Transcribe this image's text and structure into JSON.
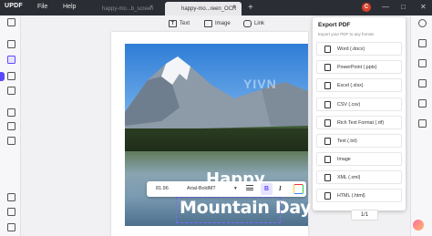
{
  "app": {
    "logo": "UPDF",
    "menu": {
      "file": "File",
      "help": "Help"
    },
    "tabs": [
      {
        "label": "happy-mo...b_screen",
        "close": "×"
      },
      {
        "label": "happy-mo...reen_OCR",
        "close": "×"
      }
    ],
    "new_tab": "+",
    "avatar_initial": "C",
    "window_controls": {
      "minimize": "—",
      "maximize": "□",
      "close": "✕"
    }
  },
  "toolbar": {
    "text_label": "Text",
    "image_label": "Image",
    "link_label": "Link"
  },
  "canvas": {
    "watermark": "YIVN",
    "overlay_line1": "Happy",
    "overlay_line2": "Mountain Day"
  },
  "format_bar": {
    "font_size": "81.96",
    "font_name": "Arial-BoldMT",
    "dropdown": "▾",
    "bold": "B",
    "italic": "I"
  },
  "export_panel": {
    "title": "Export PDF",
    "subtitle": "Export your PDF to any format",
    "items": [
      {
        "label": "Word (.docx)",
        "icon": "word-icon"
      },
      {
        "label": "PowerPoint (.pptx)",
        "icon": "powerpoint-icon"
      },
      {
        "label": "Excel (.xlsx)",
        "icon": "excel-icon"
      },
      {
        "label": "CSV (.csv)",
        "icon": "csv-icon"
      },
      {
        "label": "Rich Text Format (.rtf)",
        "icon": "rtf-icon"
      },
      {
        "label": "Text (.txt)",
        "icon": "text-icon"
      },
      {
        "label": "Image",
        "icon": "image-icon"
      },
      {
        "label": "XML (.xml)",
        "icon": "xml-icon"
      },
      {
        "label": "HTML (.html)",
        "icon": "html-icon"
      }
    ]
  },
  "pager": {
    "label": "1/1"
  },
  "colors": {
    "accent": "#5a48ff",
    "titlebar": "#2b2d34"
  }
}
